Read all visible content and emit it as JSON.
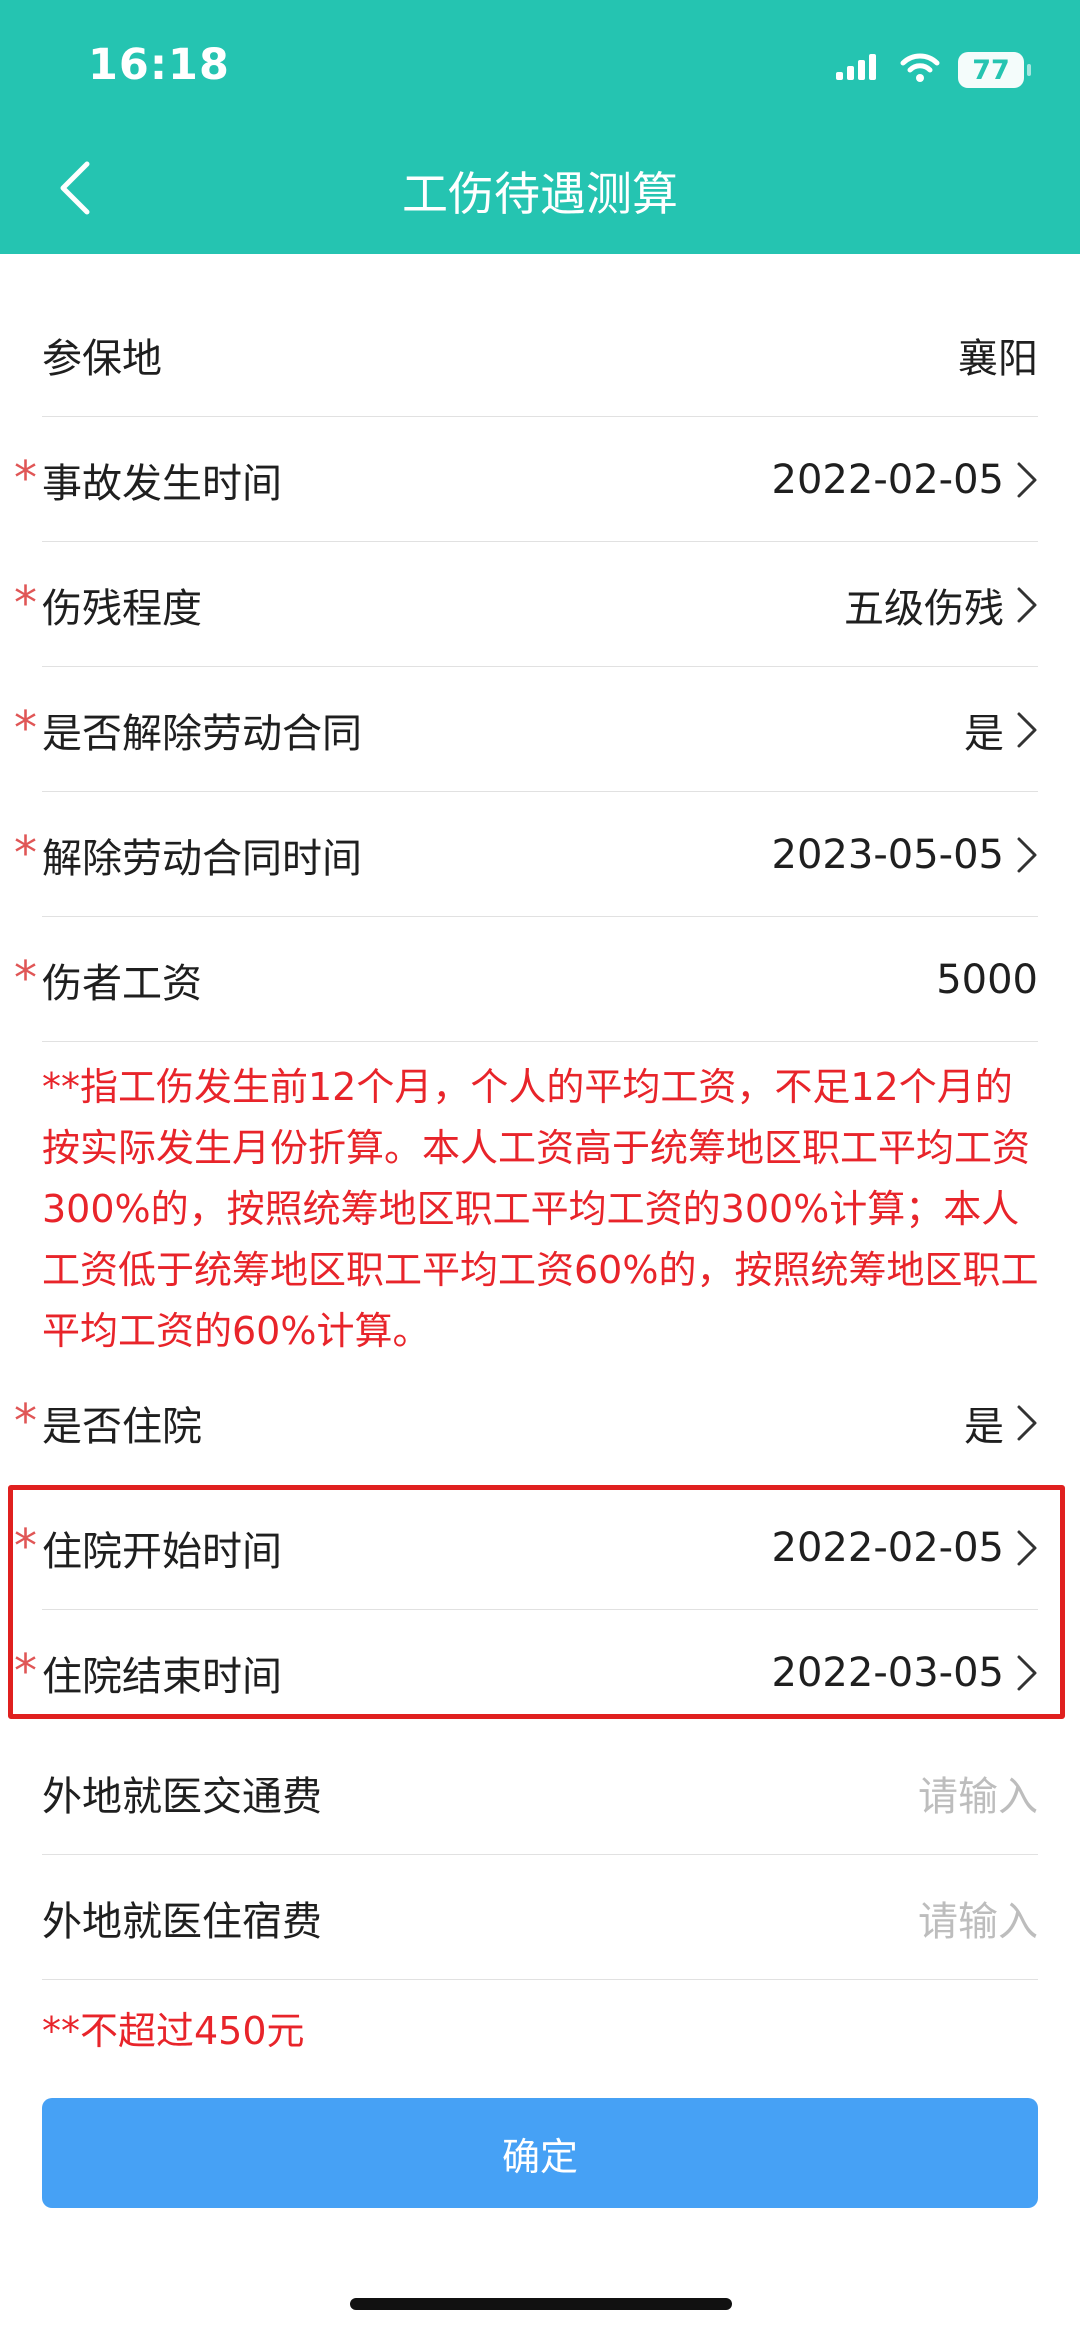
{
  "status_bar": {
    "time": "16:18",
    "battery": "77",
    "icons": [
      "signal-icon",
      "wifi-icon",
      "battery-icon"
    ]
  },
  "header": {
    "title": "工伤待遇测算",
    "back_icon": "chevron-left-icon"
  },
  "rows": [
    {
      "label": "参保地",
      "value": "襄阳",
      "required": false,
      "chevron": false
    },
    {
      "label": "事故发生时间",
      "value": "2022-02-05",
      "required": true,
      "chevron": true
    },
    {
      "label": "伤残程度",
      "value": "五级伤残",
      "required": true,
      "chevron": true
    },
    {
      "label": "是否解除劳动合同",
      "value": "是",
      "required": true,
      "chevron": true
    },
    {
      "label": "解除劳动合同时间",
      "value": "2023-05-05",
      "required": true,
      "chevron": true
    },
    {
      "label": "伤者工资",
      "value": "5000",
      "required": true,
      "chevron": false
    },
    {
      "label": "是否住院",
      "value": "是",
      "required": true,
      "chevron": true
    },
    {
      "label": "住院开始时间",
      "value": "2022-02-05",
      "required": true,
      "chevron": true
    },
    {
      "label": "住院结束时间",
      "value": "2022-03-05",
      "required": true,
      "chevron": true
    },
    {
      "label": "外地就医交通费",
      "placeholder": "请输入",
      "required": false,
      "chevron": false
    },
    {
      "label": "外地就医住宿费",
      "placeholder": "请输入",
      "required": false,
      "chevron": false
    }
  ],
  "required_mark": "*",
  "wage_note": "**指工伤发生前12个月，个人的平均工资，不足12个月的按实际发生月份折算。本人工资高于统筹地区职工平均工资300%的，按照统筹地区职工平均工资的300%计算；本人工资低于统筹地区职工平均工资60%的，按照统筹地区职工平均工资的60%计算。",
  "expense_note": "**不超过450元",
  "confirm_label": "确定",
  "colors": {
    "header": "#25c4b1",
    "note_red": "#e8242a",
    "required_star": "#e05656",
    "button_blue": "#46a1f5",
    "highlight_border": "#e0201f"
  }
}
